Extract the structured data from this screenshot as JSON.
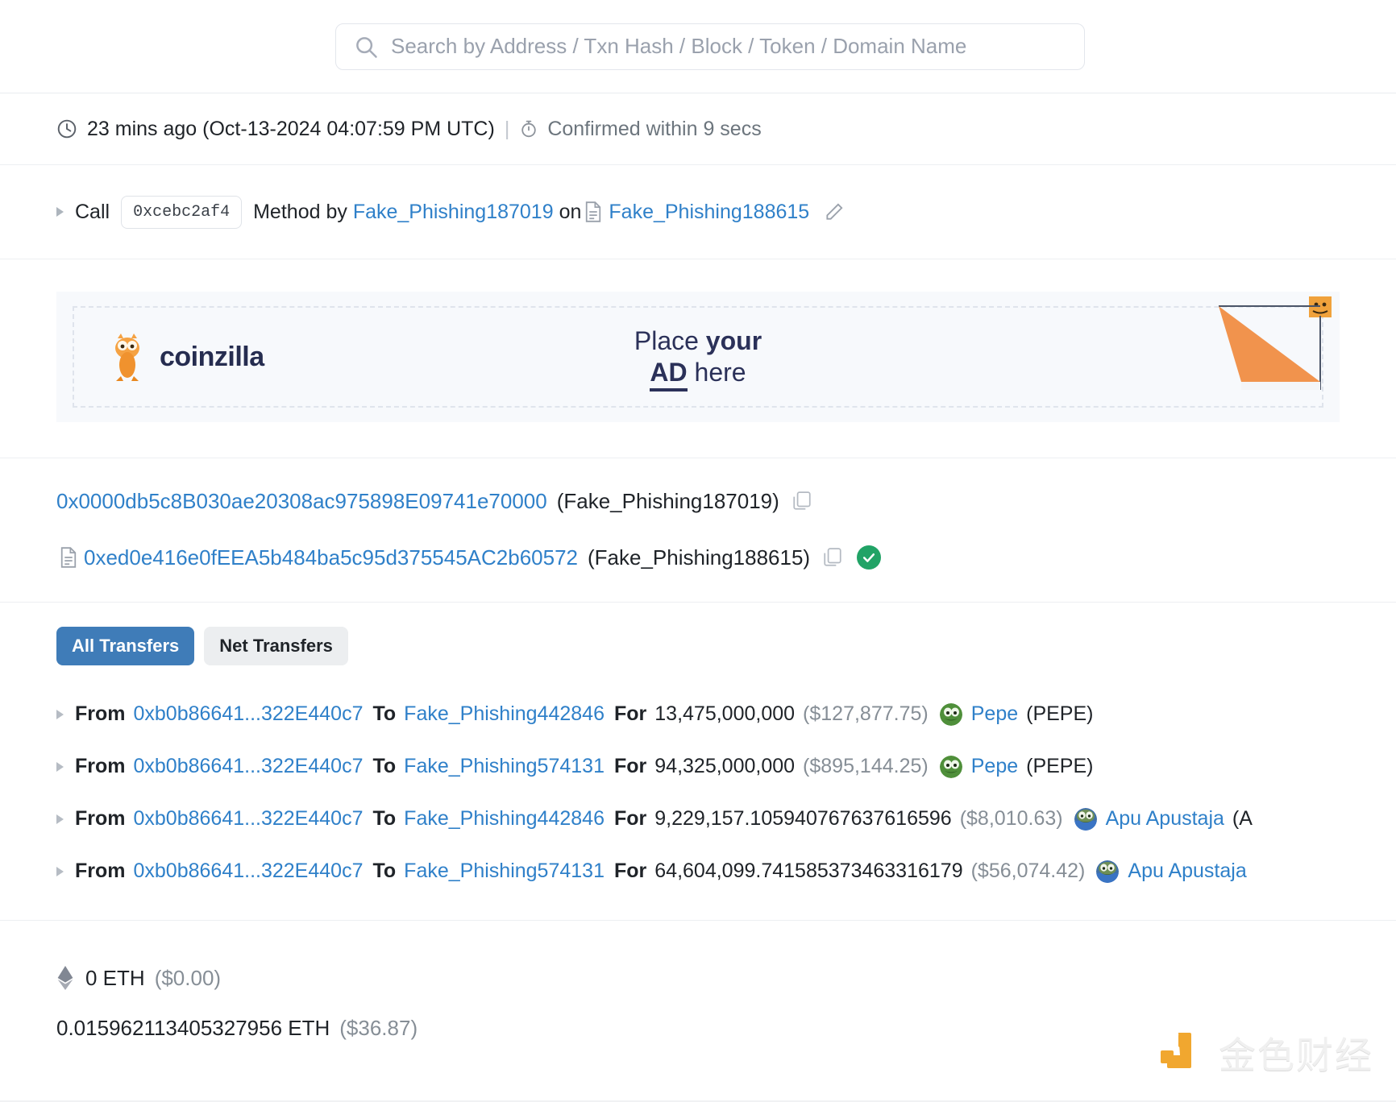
{
  "search": {
    "placeholder": "Search by Address / Txn Hash / Block / Token / Domain Name",
    "icon": "search-icon"
  },
  "timestamp": {
    "clock_icon": "clock-icon",
    "relative": "23 mins ago",
    "absolute": "(Oct-13-2024 04:07:59 PM UTC)",
    "separator": "|",
    "stopwatch_icon": "stopwatch-icon",
    "confirmation": "Confirmed within 9 secs"
  },
  "method": {
    "call_label": "Call",
    "method_id": "0xcebc2af4",
    "method_by_label": "Method by",
    "caller": "Fake_Phishing187019",
    "on_label": "on",
    "contract_icon": "contract-file-icon",
    "contract": "Fake_Phishing188615",
    "edit_icon": "pencil-icon"
  },
  "ad": {
    "brand": "coinzilla",
    "line1_plain": "Place ",
    "line1_bold": "your",
    "line2_bold": "AD",
    "line2_plain": " here",
    "logo_icon": "coinzilla-dino-icon",
    "flag_icon": "orange-flag-icon"
  },
  "addresses": [
    {
      "hash": "0x0000db5c8B030ae20308ac975898E09741e70000",
      "label": "(Fake_Phishing187019)",
      "has_contract_icon": false,
      "copy_icon": "copy-icon",
      "has_verified_badge": false
    },
    {
      "hash": "0xed0e416e0fEEA5b484ba5c95d375545AC2b60572",
      "label": "(Fake_Phishing188615)",
      "has_contract_icon": true,
      "contract_icon": "contract-file-icon",
      "copy_icon": "copy-icon",
      "has_verified_badge": true,
      "verified_icon": "check-circle-icon"
    }
  ],
  "transfers": {
    "tabs": [
      {
        "label": "All Transfers",
        "active": true
      },
      {
        "label": "Net Transfers",
        "active": false
      }
    ],
    "from_label": "From",
    "to_label": "To",
    "for_label": "For",
    "rows": [
      {
        "from": "0xb0b86641...322E440c7",
        "to": "Fake_Phishing442846",
        "amount": "13,475,000,000",
        "usd": "($127,877.75)",
        "token_name": "Pepe",
        "token_symbol": "(PEPE)",
        "token_icon": "pepe-token-icon"
      },
      {
        "from": "0xb0b86641...322E440c7",
        "to": "Fake_Phishing574131",
        "amount": "94,325,000,000",
        "usd": "($895,144.25)",
        "token_name": "Pepe",
        "token_symbol": "(PEPE)",
        "token_icon": "pepe-token-icon"
      },
      {
        "from": "0xb0b86641...322E440c7",
        "to": "Fake_Phishing442846",
        "amount": "9,229,157.105940767637616596",
        "usd": "($8,010.63)",
        "token_name": "Apu Apustaja",
        "token_symbol": "(A",
        "token_icon": "apu-token-icon"
      },
      {
        "from": "0xb0b86641...322E440c7",
        "to": "Fake_Phishing574131",
        "amount": "64,604,099.741585373463316179",
        "usd": "($56,074.42)",
        "token_name": "Apu Apustaja",
        "token_symbol": "",
        "token_icon": "apu-token-icon"
      }
    ]
  },
  "value": {
    "eth_icon": "ethereum-diamond-icon",
    "amount": "0 ETH",
    "usd": "($0.00)",
    "fee_amount": "0.015962113405327956 ETH",
    "fee_usd": "($36.87)"
  },
  "watermark": {
    "text": "金色财经",
    "logo_icon": "jinse-logo-icon",
    "accent_color": "#f0a01e"
  },
  "colors": {
    "link": "#2f80c9",
    "tab_active_bg": "#3f7cb8",
    "tab_inactive_bg": "#eceef0",
    "muted": "#868e96",
    "verified_green": "#21a366"
  }
}
